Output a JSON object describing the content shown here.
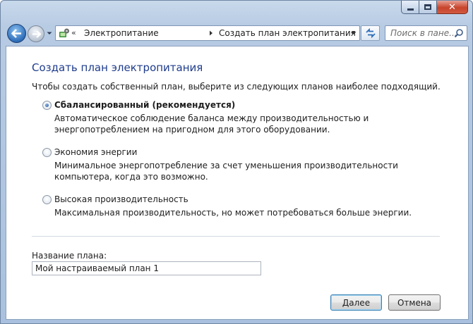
{
  "window": {
    "caption_buttons": [
      "minimize-icon",
      "maximize-icon",
      "close-icon"
    ],
    "close_glyph": "✕"
  },
  "nav": {
    "address": {
      "chevron": "«",
      "crumbs": [
        "Электропитание",
        "Создать план электропитания"
      ]
    },
    "search_placeholder": "Поиск в пане..."
  },
  "content": {
    "title": "Создать план электропитания",
    "intro": "Чтобы создать собственный план, выберите из следующих планов наиболее подходящий.",
    "plans": [
      {
        "name": "Сбалансированный (рекомендуется)",
        "description": "Автоматическое соблюдение баланса между производительностью и энергопотреблением на пригодном для этого оборудовании.",
        "selected": true
      },
      {
        "name": "Экономия энергии",
        "description": "Минимальное энергопотребление за счет уменьшения производительности компьютера, когда это возможно.",
        "selected": false
      },
      {
        "name": "Высокая производительность",
        "description": "Максимальная производительность, но может потребоваться больше энергии.",
        "selected": false
      }
    ],
    "plan_name_label": "Название плана:",
    "plan_name_value": "Мой настраиваемый план 1"
  },
  "buttons": {
    "next": "Далее",
    "cancel": "Отмена"
  },
  "colors": {
    "title": "#1e3c8c",
    "frame": "#b7cbe3",
    "close_button": "#c7442c"
  }
}
